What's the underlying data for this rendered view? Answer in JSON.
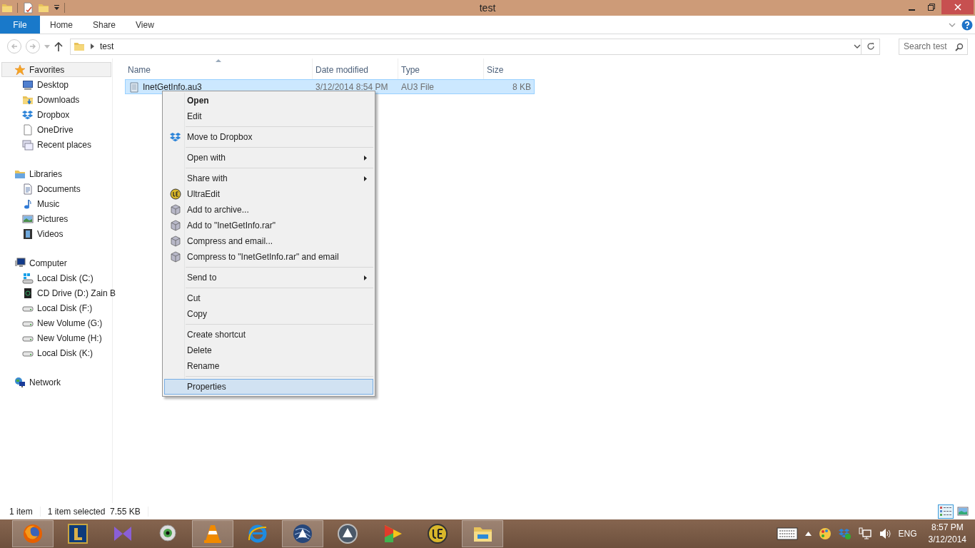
{
  "window": {
    "title": "test"
  },
  "ribbon": {
    "tabs": [
      {
        "label": "File",
        "kind": "file",
        "selected": false
      },
      {
        "label": "Home",
        "kind": "tab",
        "selected": false
      },
      {
        "label": "Share",
        "kind": "tab",
        "selected": false
      },
      {
        "label": "View",
        "kind": "tab",
        "selected": false
      }
    ]
  },
  "address": {
    "path": [
      "test"
    ],
    "search_placeholder": "Search test"
  },
  "sidebar": {
    "groups": [
      {
        "label": "Favorites",
        "selected": true,
        "children": [
          {
            "label": "Desktop",
            "selected": false
          },
          {
            "label": "Downloads",
            "selected": false
          },
          {
            "label": "Dropbox",
            "selected": false
          },
          {
            "label": "OneDrive",
            "selected": false
          },
          {
            "label": "Recent places",
            "selected": false
          }
        ]
      },
      {
        "label": "Libraries",
        "selected": false,
        "children": [
          {
            "label": "Documents",
            "selected": false
          },
          {
            "label": "Music",
            "selected": false
          },
          {
            "label": "Pictures",
            "selected": false
          },
          {
            "label": "Videos",
            "selected": false
          }
        ]
      },
      {
        "label": "Computer",
        "selected": false,
        "children": [
          {
            "label": "Local Disk (C:)",
            "selected": false
          },
          {
            "label": "CD Drive (D:) Zain B",
            "selected": false
          },
          {
            "label": "Local Disk (F:)",
            "selected": false
          },
          {
            "label": "New Volume (G:)",
            "selected": false
          },
          {
            "label": "New Volume (H:)",
            "selected": false
          },
          {
            "label": "Local Disk (K:)",
            "selected": false
          }
        ]
      },
      {
        "label": "Network",
        "selected": false
      }
    ]
  },
  "table": {
    "columns": [
      {
        "label": "Name",
        "sorted": true
      },
      {
        "label": "Date modified",
        "sorted": false
      },
      {
        "label": "Type",
        "sorted": false
      },
      {
        "label": "Size",
        "sorted": false
      }
    ],
    "rows": [
      {
        "name": "InetGetInfo.au3",
        "date": "3/12/2014 8:54 PM",
        "type": "AU3 File",
        "size": "8 KB",
        "selected": true
      }
    ]
  },
  "context_menu": {
    "items": [
      {
        "kind": "plain",
        "label": "Open",
        "bold": true,
        "selected": false
      },
      {
        "kind": "plain",
        "label": "Edit",
        "bold": false,
        "selected": false
      },
      {
        "kind": "separator"
      },
      {
        "kind": "dropbox",
        "label": "Move to Dropbox",
        "bold": false,
        "selected": false
      },
      {
        "kind": "separator"
      },
      {
        "kind": "submenu",
        "label": "Open with",
        "bold": false,
        "selected": false
      },
      {
        "kind": "separator"
      },
      {
        "kind": "submenu",
        "label": "Share with",
        "bold": false,
        "selected": false
      },
      {
        "kind": "ultraedit",
        "label": "UltraEdit",
        "bold": false,
        "selected": false
      },
      {
        "kind": "archive",
        "label": "Add to archive...",
        "bold": false,
        "selected": false
      },
      {
        "kind": "archive",
        "label": "Add to \"InetGetInfo.rar\"",
        "bold": false,
        "selected": false
      },
      {
        "kind": "archive",
        "label": "Compress and email...",
        "bold": false,
        "selected": false
      },
      {
        "kind": "archive",
        "label": "Compress to \"InetGetInfo.rar\" and email",
        "bold": false,
        "selected": false
      },
      {
        "kind": "separator"
      },
      {
        "kind": "submenu",
        "label": "Send to",
        "bold": false,
        "selected": false
      },
      {
        "kind": "separator"
      },
      {
        "kind": "plain",
        "label": "Cut",
        "bold": false,
        "selected": false
      },
      {
        "kind": "plain",
        "label": "Copy",
        "bold": false,
        "selected": false
      },
      {
        "kind": "separator"
      },
      {
        "kind": "plain",
        "label": "Create shortcut",
        "bold": false,
        "selected": false
      },
      {
        "kind": "plain",
        "label": "Delete",
        "bold": false,
        "selected": false
      },
      {
        "kind": "plain",
        "label": "Rename",
        "bold": false,
        "selected": false
      },
      {
        "kind": "separator"
      },
      {
        "kind": "plain",
        "label": "Properties",
        "bold": false,
        "selected": true
      }
    ]
  },
  "status_bar": {
    "item_count": "1 item",
    "selection": "1 item selected  7.55 KB",
    "views": [
      {
        "kind": "details",
        "selected": true
      },
      {
        "kind": "large-icons",
        "selected": false
      }
    ]
  },
  "taskbar": {
    "apps": [
      {
        "kind": "firefox",
        "running": true
      },
      {
        "kind": "game",
        "running": false
      },
      {
        "kind": "bowtie",
        "running": false
      },
      {
        "kind": "eyeball",
        "running": false
      },
      {
        "kind": "cone",
        "running": true
      },
      {
        "kind": "ie",
        "running": false
      },
      {
        "kind": "sphere",
        "running": true
      },
      {
        "kind": "sphere-grey",
        "running": false
      },
      {
        "kind": "puzzle",
        "running": false
      },
      {
        "kind": "ue",
        "running": false
      },
      {
        "kind": "explorer",
        "running": true
      }
    ],
    "language": "ENG",
    "time": "8:57 PM",
    "date": "3/12/2014"
  }
}
